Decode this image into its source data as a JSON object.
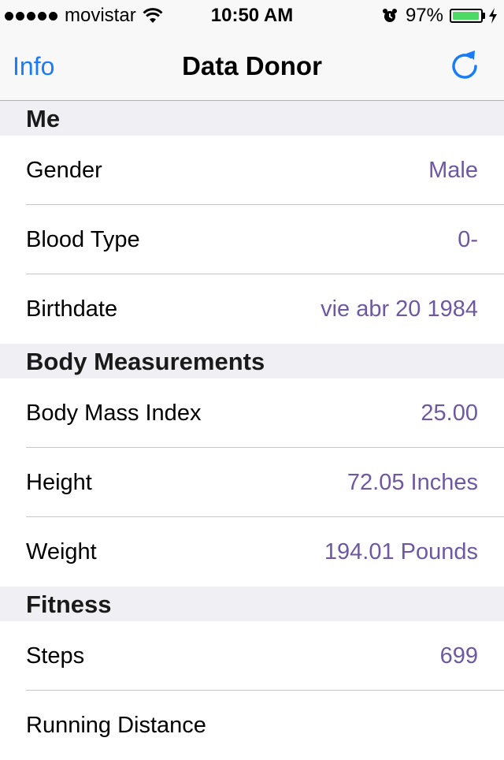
{
  "status_bar": {
    "carrier": "movistar",
    "time": "10:50 AM",
    "battery_percent": "97%",
    "battery_level": 0.97,
    "signal_bars": 5,
    "icons": [
      "wifi-icon",
      "alarm-icon",
      "charging-icon"
    ]
  },
  "nav": {
    "left_button": "Info",
    "title": "Data Donor",
    "right_icon": "refresh-icon",
    "accent_color": "#1a7cf5"
  },
  "value_color": "#6e58a2",
  "sections": [
    {
      "title": "Me",
      "rows": [
        {
          "label": "Gender",
          "value": "Male"
        },
        {
          "label": "Blood Type",
          "value": "0-"
        },
        {
          "label": "Birthdate",
          "value": "vie abr 20 1984"
        }
      ]
    },
    {
      "title": "Body Measurements",
      "rows": [
        {
          "label": "Body Mass Index",
          "value": "25.00"
        },
        {
          "label": "Height",
          "value": "72.05 Inches"
        },
        {
          "label": "Weight",
          "value": "194.01 Pounds"
        }
      ]
    },
    {
      "title": "Fitness",
      "rows": [
        {
          "label": "Steps",
          "value": "699"
        },
        {
          "label": "Running Distance",
          "value": ""
        }
      ]
    }
  ]
}
